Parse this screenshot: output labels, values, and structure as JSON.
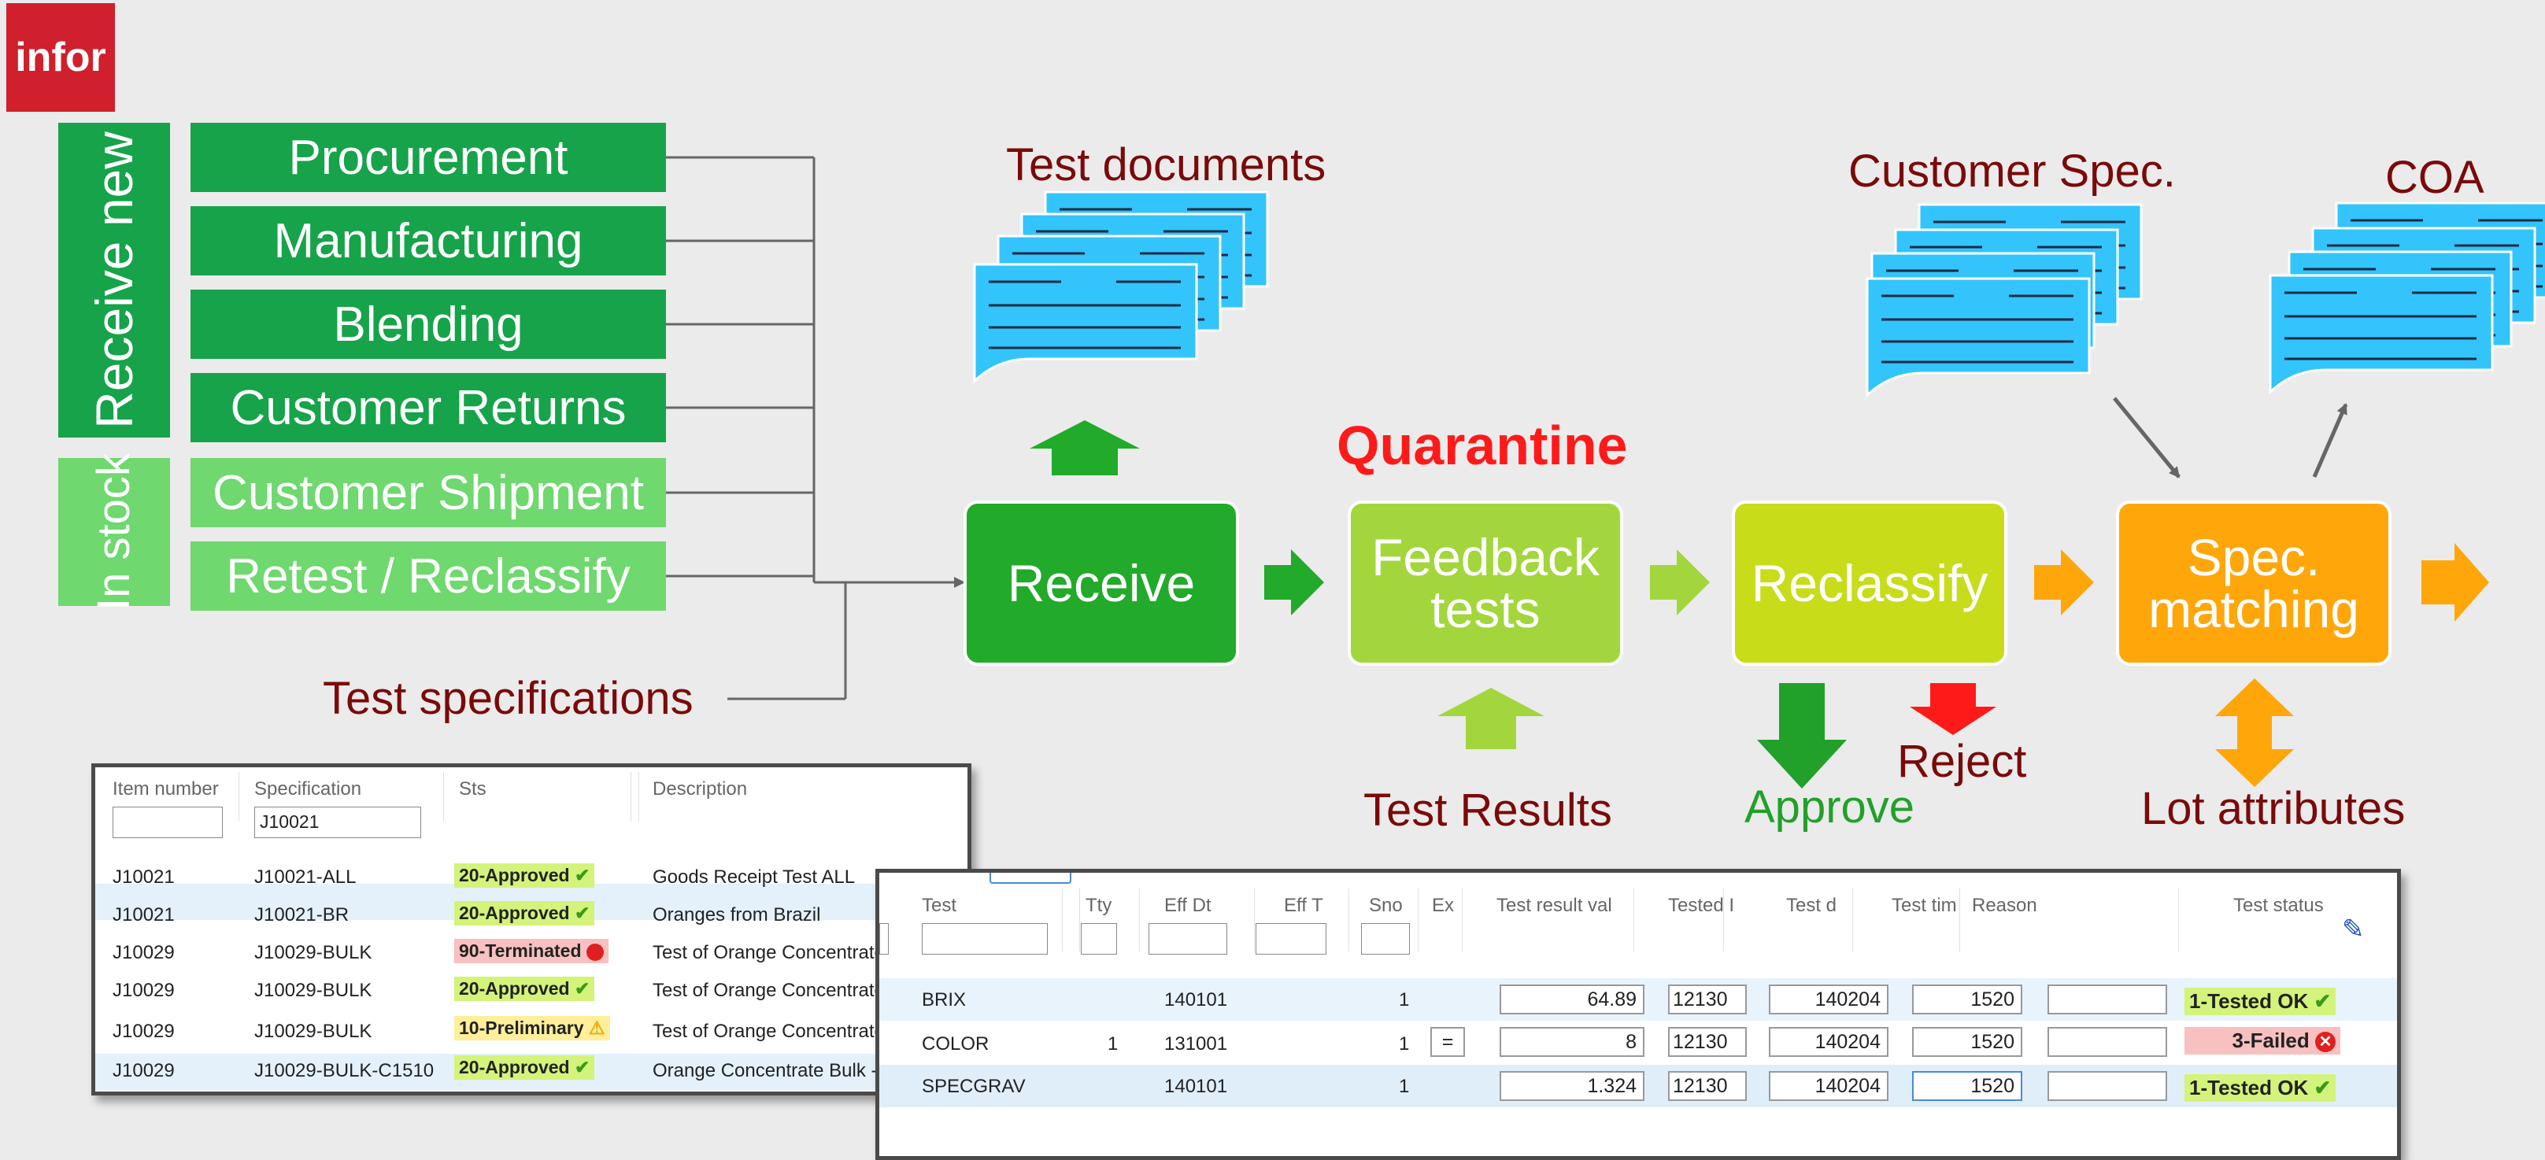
{
  "logo": "infor",
  "groups": {
    "receive_new": "Receive new",
    "in_stock": "In stock"
  },
  "sources": [
    "Procurement",
    "Manufacturing",
    "Blending",
    "Customer Returns",
    "Customer Shipment",
    "Retest / Reclassify"
  ],
  "labels": {
    "test_specifications": "Test specifications",
    "test_documents": "Test documents",
    "customer_spec": "Customer Spec.",
    "coa": "COA",
    "quarantine": "Quarantine",
    "test_results": "Test Results",
    "approve": "Approve",
    "reject": "Reject",
    "lot_attributes": "Lot attributes"
  },
  "stages": {
    "receive": "Receive",
    "feedback_1": "Feedback",
    "feedback_2": "tests",
    "reclassify": "Reclassify",
    "spec_1": "Spec.",
    "spec_2": "matching"
  },
  "colors": {
    "receive": "#22aa2a",
    "feedback": "#a3d63d",
    "reclassify": "#c8dc1a",
    "spec": "#ffa70a",
    "doc": "#33c4fb",
    "label": "#7a0a0a",
    "red": "#ff1a1a"
  },
  "spec_table": {
    "headers": {
      "item": "Item number",
      "spec": "Specification",
      "sts": "Sts",
      "desc": "Description"
    },
    "filter_spec": "J10021",
    "rows": [
      {
        "item": "J10021",
        "spec": "J10021-ALL",
        "sts": "20-Approved",
        "desc": "Goods Receipt Test ALL"
      },
      {
        "item": "J10021",
        "spec": "J10021-BR",
        "sts": "20-Approved",
        "desc": "Oranges from Brazil"
      },
      {
        "item": "J10029",
        "spec": "J10029-BULK",
        "sts": "90-Terminated",
        "desc": "Test of Orange Concentrate"
      },
      {
        "item": "J10029",
        "spec": "J10029-BULK",
        "sts": "20-Approved",
        "desc": "Test of Orange Concentrate"
      },
      {
        "item": "J10029",
        "spec": "J10029-BULK",
        "sts": "10-Preliminary",
        "desc": "Test of Orange Concentrate"
      },
      {
        "item": "J10029",
        "spec": "J10029-BULK-C1510",
        "sts": "20-Approved",
        "desc": "Orange Concentrate Bulk -"
      }
    ]
  },
  "result_table": {
    "headers": {
      "test": "Test",
      "tty": "Tty",
      "effdt": "Eff Dt",
      "efft": "Eff T",
      "sno": "Sno",
      "ex": "Ex",
      "resval": "Test result val",
      "tested": "Tested I",
      "testd": "Test d",
      "testtim": "Test tim",
      "reason": "Reason",
      "status": "Test status"
    },
    "rows": [
      {
        "test": "BRIX",
        "tty": "",
        "effdt": "140101",
        "sno": "1",
        "ex": "",
        "val": "64.89",
        "tested": "12130",
        "testd": "140204",
        "tim": "1520",
        "status": "1-Tested OK"
      },
      {
        "test": "COLOR",
        "tty": "1",
        "effdt": "131001",
        "sno": "1",
        "ex": "=",
        "val": "8",
        "tested": "12130",
        "testd": "140204",
        "tim": "1520",
        "status": "3-Failed"
      },
      {
        "test": "SPECGRAV",
        "tty": "",
        "effdt": "140101",
        "sno": "1",
        "ex": "",
        "val": "1.324",
        "tested": "12130",
        "testd": "140204",
        "tim": "1520",
        "status": "1-Tested OK"
      }
    ]
  }
}
